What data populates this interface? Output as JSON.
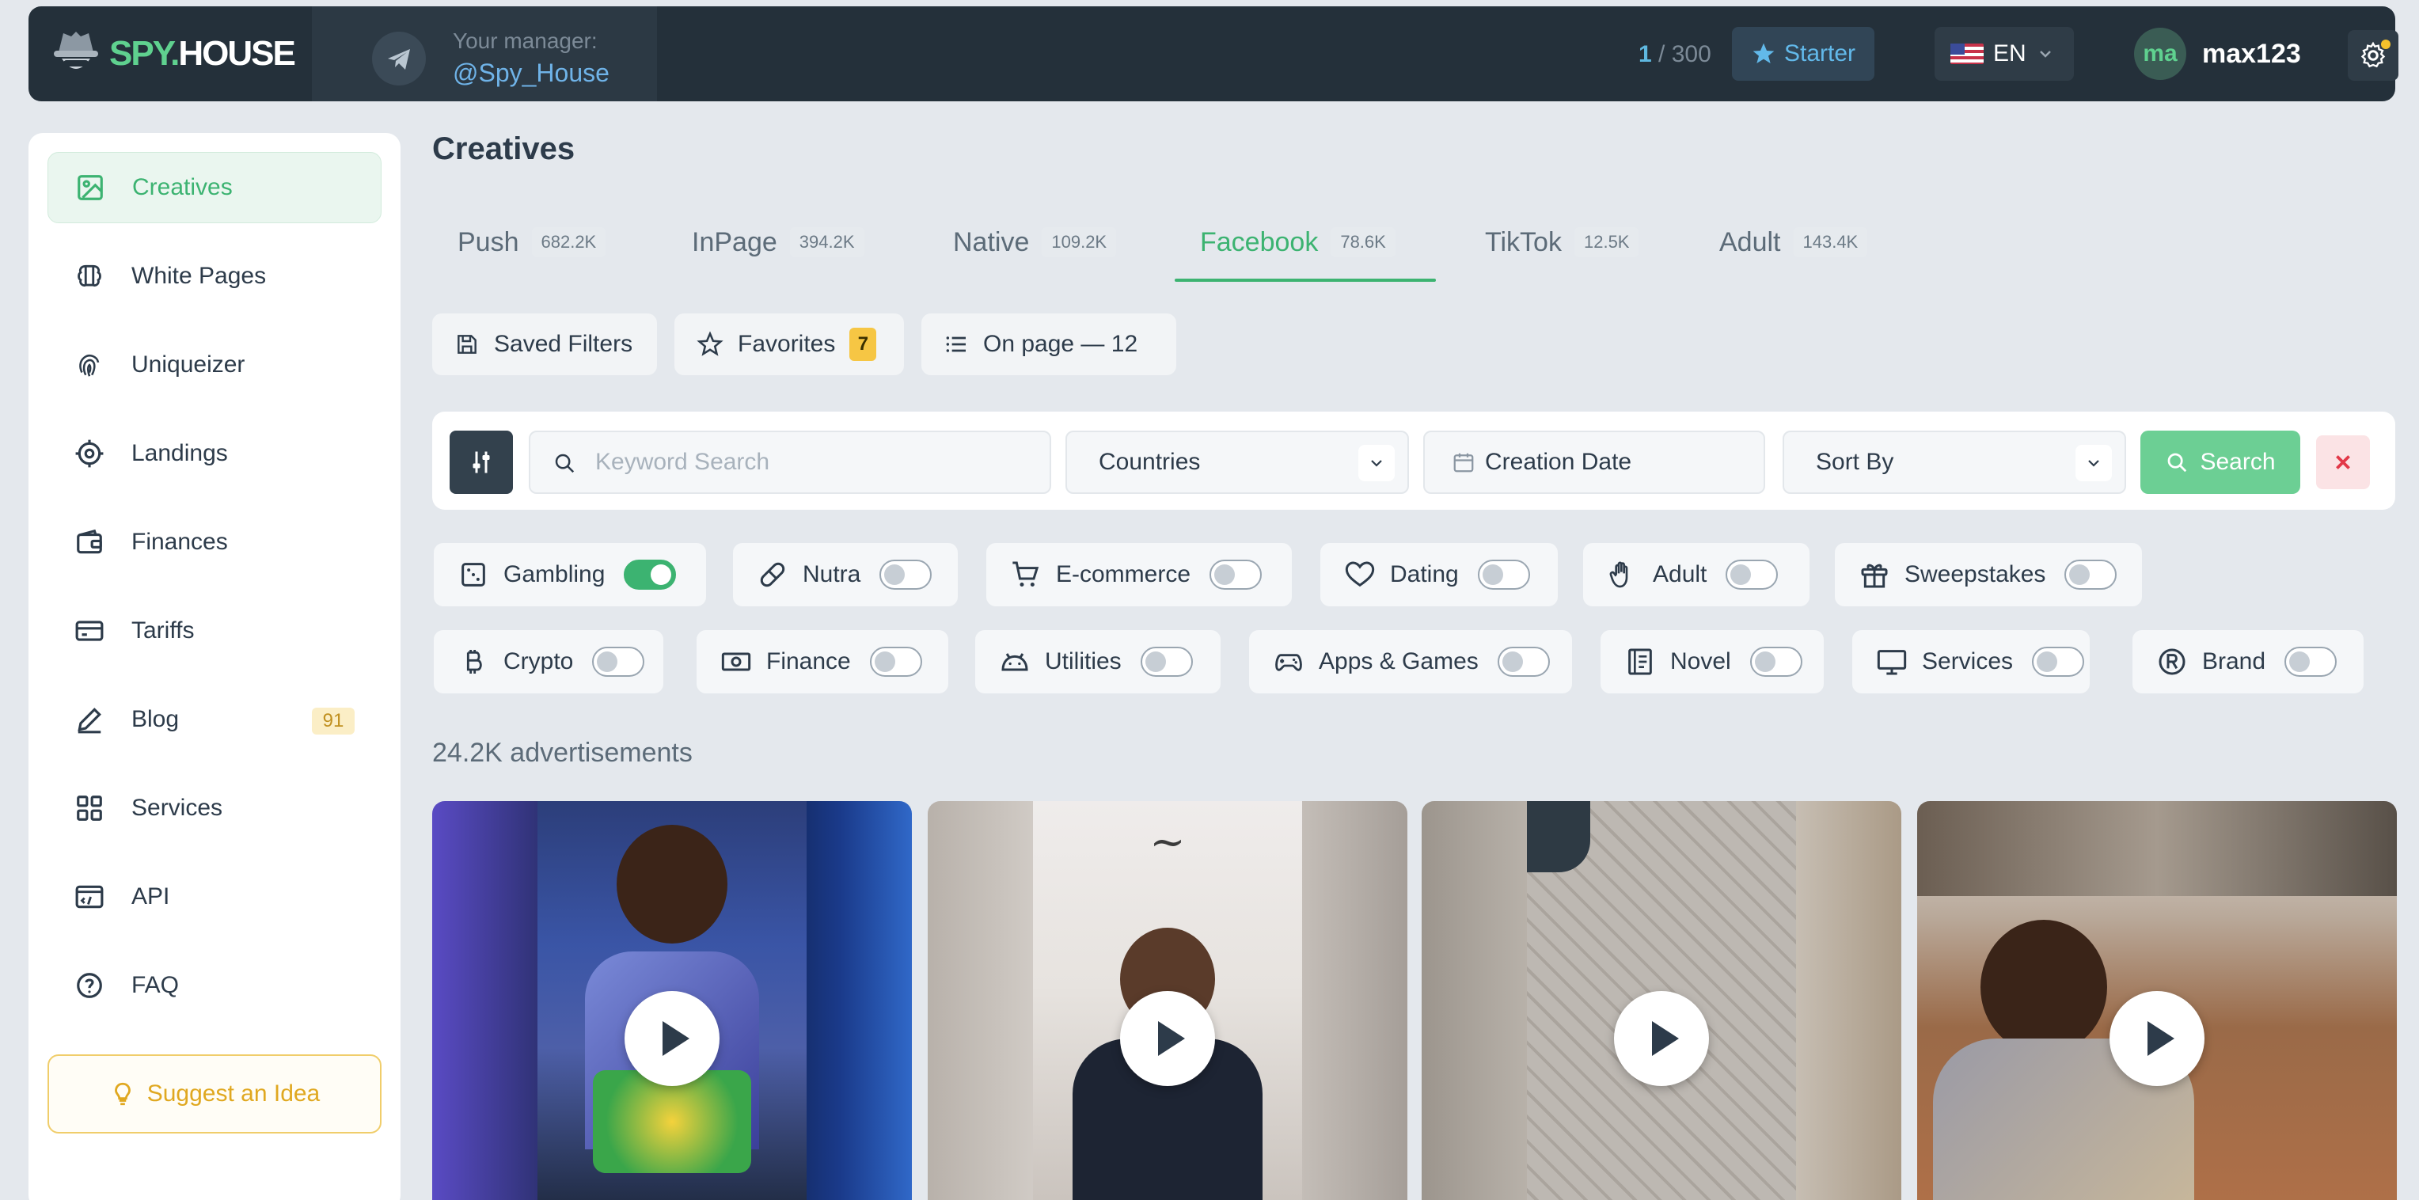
{
  "brand": {
    "spy": "SPY.",
    "house": "HOUSE"
  },
  "manager": {
    "label": "Your manager:",
    "handle": "@Spy_House"
  },
  "usage": {
    "used": "1",
    "limit": "/ 300"
  },
  "plan": "Starter",
  "language": "EN",
  "user": {
    "initials": "ma",
    "name": "max123"
  },
  "sidebar": {
    "items": [
      {
        "label": "Creatives",
        "icon": "image-icon"
      },
      {
        "label": "White Pages",
        "icon": "brain-icon"
      },
      {
        "label": "Uniqueizer",
        "icon": "fingerprint-icon"
      },
      {
        "label": "Landings",
        "icon": "target-icon"
      },
      {
        "label": "Finances",
        "icon": "wallet-icon"
      },
      {
        "label": "Tariffs",
        "icon": "card-icon"
      },
      {
        "label": "Blog",
        "icon": "pen-icon",
        "badge": "91"
      },
      {
        "label": "Services",
        "icon": "grid-icon"
      },
      {
        "label": "API",
        "icon": "api-icon"
      },
      {
        "label": "FAQ",
        "icon": "question-icon"
      }
    ],
    "suggest": "Suggest an Idea"
  },
  "main": {
    "title": "Creatives",
    "tabs": [
      {
        "label": "Push",
        "count": "682.2K"
      },
      {
        "label": "InPage",
        "count": "394.2K"
      },
      {
        "label": "Native",
        "count": "109.2K"
      },
      {
        "label": "Facebook",
        "count": "78.6K"
      },
      {
        "label": "TikTok",
        "count": "12.5K"
      },
      {
        "label": "Adult",
        "count": "143.4K"
      }
    ],
    "saved_filters": "Saved Filters",
    "favorites": {
      "label": "Favorites",
      "count": "7"
    },
    "on_page": "On page — 12",
    "filters": {
      "keyword_placeholder": "Keyword Search",
      "countries": "Countries",
      "creation_date": "Creation Date",
      "sort_by": "Sort By",
      "search": "Search"
    },
    "categories_row1": [
      {
        "label": "Gambling",
        "on": true
      },
      {
        "label": "Nutra",
        "on": false
      },
      {
        "label": "E-commerce",
        "on": false
      },
      {
        "label": "Dating",
        "on": false
      },
      {
        "label": "Adult",
        "on": false
      },
      {
        "label": "Sweepstakes",
        "on": false
      }
    ],
    "categories_row2": [
      {
        "label": "Crypto",
        "on": false
      },
      {
        "label": "Finance",
        "on": false
      },
      {
        "label": "Utilities",
        "on": false
      },
      {
        "label": "Apps & Games",
        "on": false
      },
      {
        "label": "Novel",
        "on": false
      },
      {
        "label": "Services",
        "on": false
      },
      {
        "label": "Brand",
        "on": false
      }
    ],
    "ads_count": "24.2K  advertisements"
  },
  "colors": {
    "accent": "#3cb371",
    "topbar": "#24303a",
    "badge": "#f6c644",
    "danger": "#e23848"
  }
}
